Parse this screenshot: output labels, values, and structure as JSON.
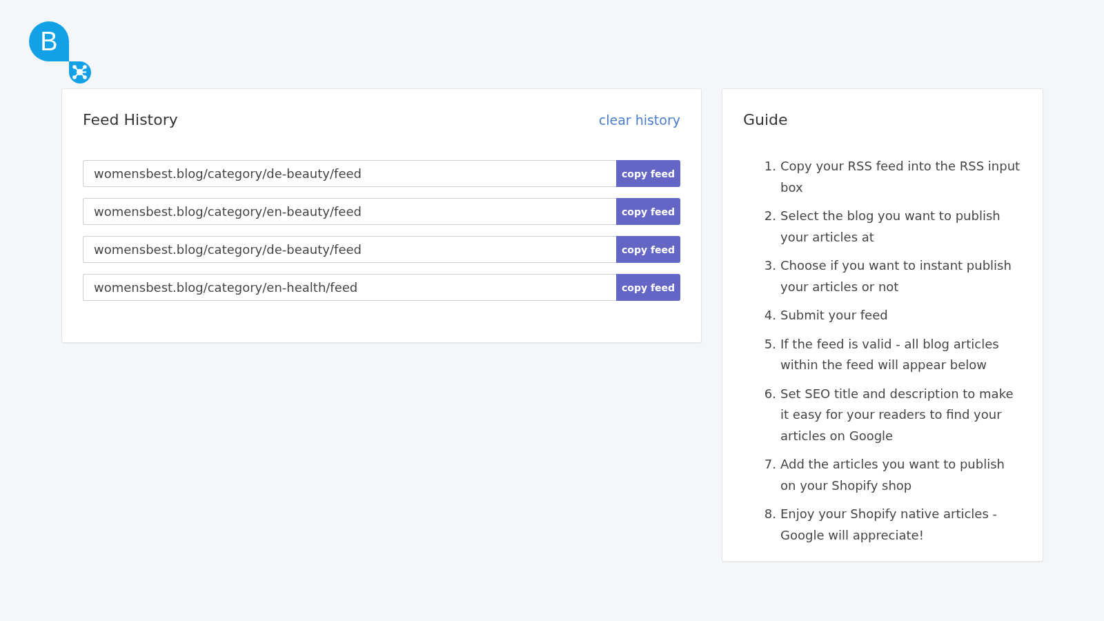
{
  "logo": {
    "letter": "B"
  },
  "feed_history": {
    "title": "Feed History",
    "clear_link": "clear history",
    "feeds": [
      {
        "url": "womensbest.blog/category/de-beauty/feed",
        "button": "copy feed"
      },
      {
        "url": "womensbest.blog/category/en-beauty/feed",
        "button": "copy feed"
      },
      {
        "url": "womensbest.blog/category/de-beauty/feed",
        "button": "copy feed"
      },
      {
        "url": "womensbest.blog/category/en-health/feed",
        "button": "copy feed"
      }
    ]
  },
  "guide": {
    "title": "Guide",
    "steps": [
      {
        "number": "1.",
        "text": "Copy your RSS feed into the RSS input box"
      },
      {
        "number": "2.",
        "text": "Select the blog you want to publish your articles at"
      },
      {
        "number": "3.",
        "text": "Choose if you want to instant publish your articles or not"
      },
      {
        "number": "4.",
        "text": "Submit your feed"
      },
      {
        "number": "5.",
        "text": "If the feed is valid - all blog articles within the feed will appear below"
      },
      {
        "number": "6.",
        "text": "Set SEO title and description to make it easy for your readers to find your articles on Google"
      },
      {
        "number": "7.",
        "text": "Add the articles you want to publish on your Shopify shop"
      },
      {
        "number": "8.",
        "text": "Enjoy your Shopify native articles - Google will appreciate!"
      }
    ]
  }
}
